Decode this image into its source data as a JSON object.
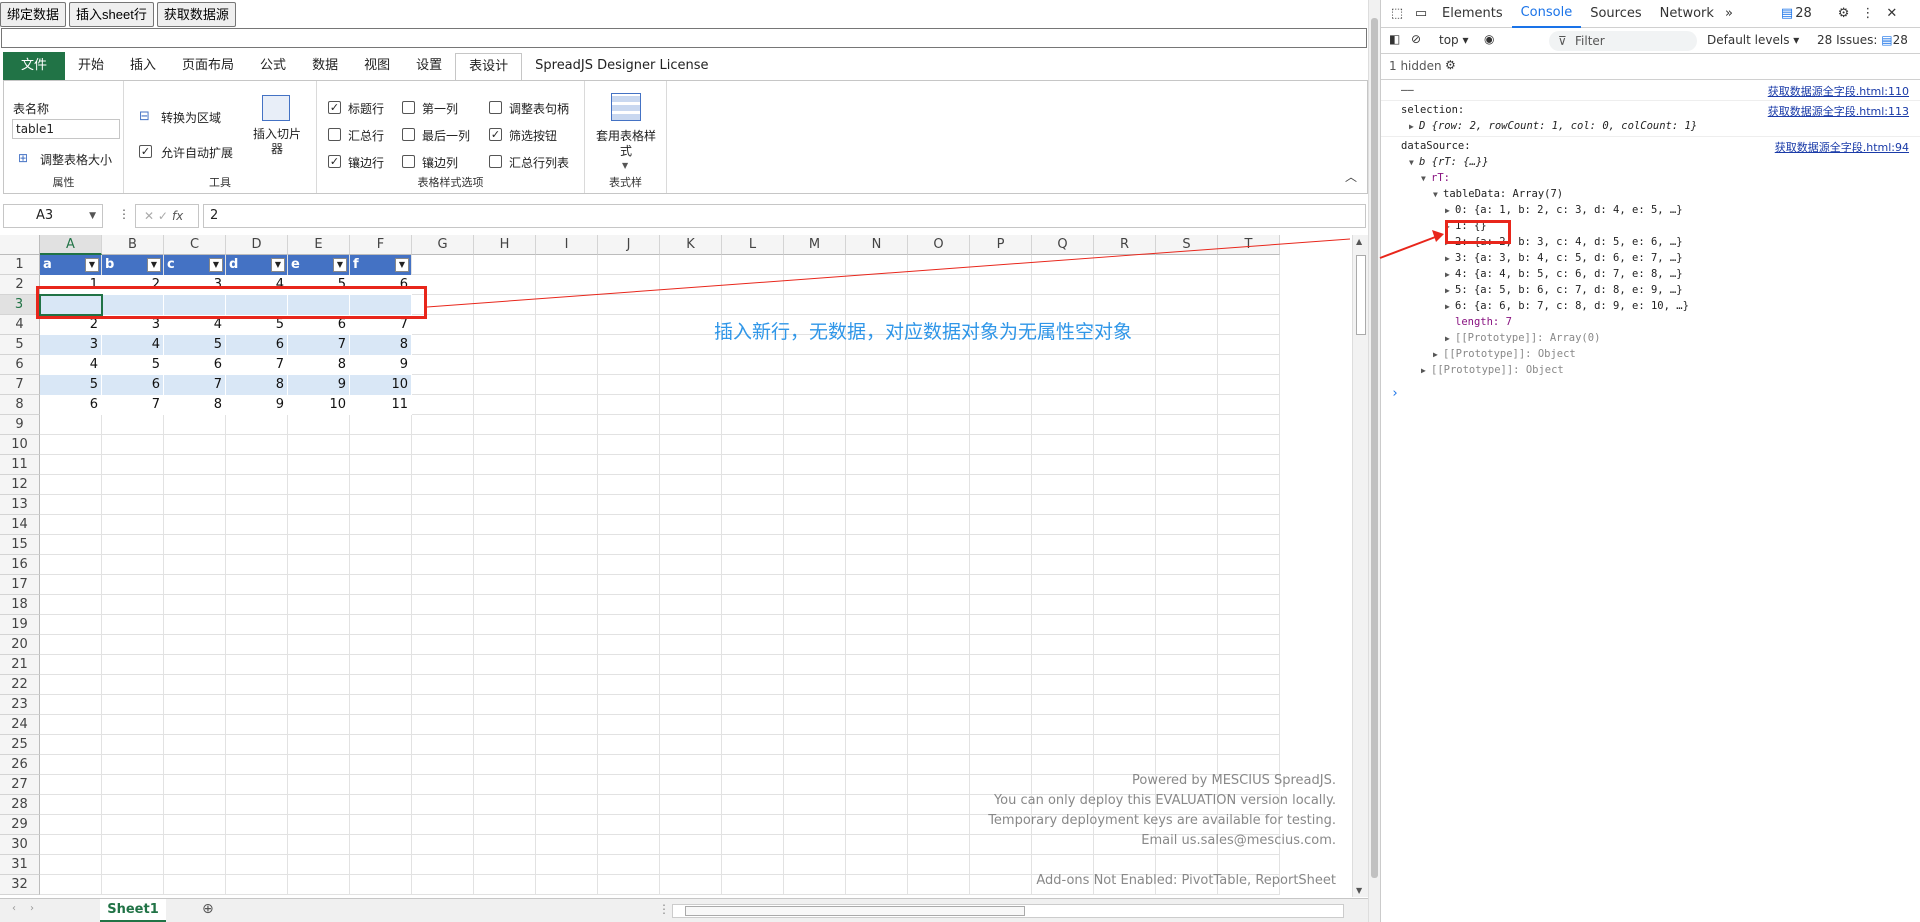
{
  "topButtons": [
    "绑定数据",
    "插入sheet行",
    "获取数据源"
  ],
  "ribbonTabs": [
    "文件",
    "开始",
    "插入",
    "页面布局",
    "公式",
    "数据",
    "视图",
    "设置",
    "表设计",
    "SpreadJS Designer License"
  ],
  "ribbon": {
    "props": {
      "tableNameLabel": "表名称",
      "tableName": "table1",
      "resize": "调整表格大小",
      "title": "属性"
    },
    "tools": {
      "toRange": "转换为区域",
      "autoExpand": "允许自动扩展",
      "slicer": "插入切片器",
      "title": "工具"
    },
    "options": {
      "headerRow": "标题行",
      "firstCol": "第一列",
      "resizeHandle": "调整表句柄",
      "totalRow": "汇总行",
      "lastCol": "最后一列",
      "filterBtn": "筛选按钮",
      "bandedRows": "镶边行",
      "bandedCols": "镶边列",
      "totalList": "汇总行列表",
      "title": "表格样式选项"
    },
    "styles": {
      "apply": "套用表格样式",
      "title": "表式样"
    }
  },
  "formulaBar": {
    "cellRef": "A3",
    "fx": "fx",
    "value": "2"
  },
  "columns": [
    "A",
    "B",
    "C",
    "D",
    "E",
    "F",
    "G",
    "H",
    "I",
    "J",
    "K",
    "L",
    "M",
    "N",
    "O",
    "P",
    "Q",
    "R",
    "S",
    "T"
  ],
  "rows": [
    "1",
    "2",
    "3",
    "4",
    "5",
    "6",
    "7",
    "8",
    "9",
    "10",
    "11",
    "12",
    "13",
    "14",
    "15",
    "16",
    "17",
    "18",
    "19",
    "20",
    "21",
    "22",
    "23",
    "24",
    "25",
    "26",
    "27",
    "28",
    "29",
    "30",
    "31",
    "32"
  ],
  "tableHeaders": [
    "a",
    "b",
    "c",
    "d",
    "e",
    "f"
  ],
  "tableRows": [
    [
      "1",
      "2",
      "3",
      "4",
      "5",
      "6"
    ],
    [
      "",
      "",
      "",
      "",
      "",
      ""
    ],
    [
      "2",
      "3",
      "4",
      "5",
      "6",
      "7"
    ],
    [
      "3",
      "4",
      "5",
      "6",
      "7",
      "8"
    ],
    [
      "4",
      "5",
      "6",
      "7",
      "8",
      "9"
    ],
    [
      "5",
      "6",
      "7",
      "8",
      "9",
      "10"
    ],
    [
      "6",
      "7",
      "8",
      "9",
      "10",
      "11"
    ]
  ],
  "annotation": "插入新行，无数据，对应数据对象为无属性空对象",
  "watermark": [
    "Powered by MESCIUS SpreadJS.",
    "You can only deploy this EVALUATION version locally.",
    "Temporary deployment keys are available for testing.",
    "Email us.sales@mescius.com.",
    "Add-ons Not Enabled: PivotTable, ReportSheet"
  ],
  "sheetTab": "Sheet1",
  "devtools": {
    "tabs": [
      "Elements",
      "Console",
      "Sources",
      "Network"
    ],
    "badge": "28",
    "context": "top",
    "filter": "Filter",
    "levels": "Default levels",
    "issues": "28 Issues:",
    "issuesCount": "28",
    "hidden": "1 hidden",
    "console": {
      "dash": "——",
      "src1": "获取数据源全字段.html:110",
      "selectionKey": "selection:",
      "src2": "获取数据源全字段.html:113",
      "selectionVal": "D {row: 2, rowCount: 1, col: 0, colCount: 1}",
      "dataSourceKey": "dataSource:",
      "src3": "获取数据源全字段.html:94",
      "dataSourceVal": "b {rT: {…}}",
      "rT": "rT:",
      "tableData": "tableData: Array(7)",
      "items": [
        "0: {a: 1, b: 2, c: 3, d: 4, e: 5, …}",
        "1: {}",
        "2: {a: 2, b: 3, c: 4, d: 5, e: 6, …}",
        "3: {a: 3, b: 4, c: 5, d: 6, e: 7, …}",
        "4: {a: 4, b: 5, c: 6, d: 7, e: 8, …}",
        "5: {a: 5, b: 6, c: 7, d: 8, e: 9, …}",
        "6: {a: 6, b: 7, c: 8, d: 9, e: 10, …}"
      ],
      "length": "length: 7",
      "proto1": "[[Prototype]]: Array(0)",
      "proto2": "[[Prototype]]: Object",
      "proto3": "[[Prototype]]: Object",
      "prompt": "›"
    }
  },
  "colors": {
    "excelGreen": "#217346",
    "tableHeader": "#4472c4",
    "bandedRow": "#d9e7f6",
    "annotationRed": "#e8261b",
    "annotationBlue": "#2f96e8"
  }
}
